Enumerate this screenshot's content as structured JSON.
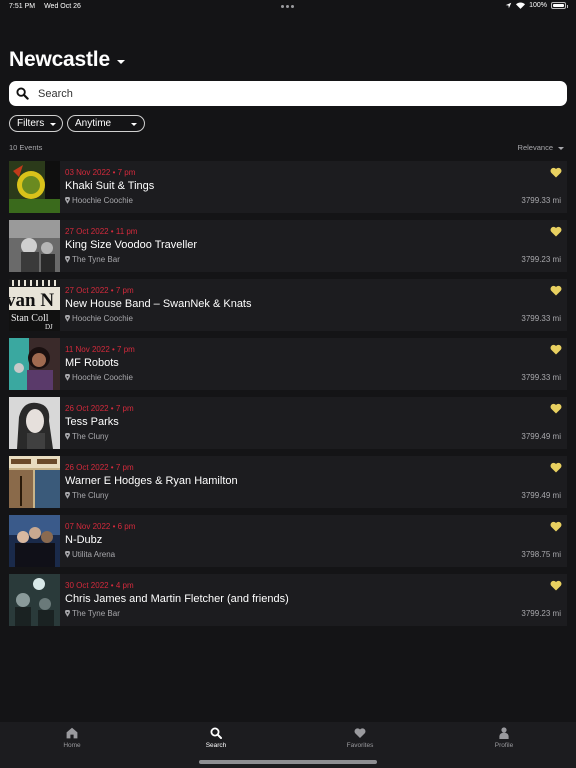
{
  "status_bar": {
    "time": "7:51 PM",
    "date": "Wed Oct 26",
    "battery": "100%"
  },
  "header": {
    "city": "Newcastle"
  },
  "search": {
    "placeholder": "Search"
  },
  "filters": {
    "filters_label": "Filters",
    "time_label": "Anytime"
  },
  "results": {
    "count_label": "10 Events",
    "sort_label": "Relevance"
  },
  "accent_color": "#d42a3c",
  "favorite_color": "#e8d060",
  "events": [
    {
      "date": "03 Nov 2022 • 7 pm",
      "title": "Khaki Suit & Tings",
      "venue": "Hoochie Coochie",
      "distance": "3799.33 mi"
    },
    {
      "date": "27 Oct 2022 • 11 pm",
      "title": "King Size Voodoo Traveller",
      "venue": "The Tyne Bar",
      "distance": "3799.23 mi"
    },
    {
      "date": "27 Oct 2022 • 7 pm",
      "title": "New House Band – SwanNek & Knats",
      "venue": "Hoochie Coochie",
      "distance": "3799.33 mi",
      "thumb_text_1": "van N",
      "thumb_text_2": "Stan Coll",
      "thumb_text_3": "DJ"
    },
    {
      "date": "11 Nov 2022 • 7 pm",
      "title": "MF Robots",
      "venue": "Hoochie Coochie",
      "distance": "3799.33 mi"
    },
    {
      "date": "26 Oct 2022 • 7 pm",
      "title": "Tess Parks",
      "venue": "The Cluny",
      "distance": "3799.49 mi"
    },
    {
      "date": "26 Oct 2022 • 7 pm",
      "title": "Warner E Hodges & Ryan Hamilton",
      "venue": "The Cluny",
      "distance": "3799.49 mi"
    },
    {
      "date": "07 Nov 2022 • 6 pm",
      "title": "N-Dubz",
      "venue": "Utilita Arena",
      "distance": "3798.75 mi"
    },
    {
      "date": "30 Oct 2022 • 4 pm",
      "title": "Chris James and Martin Fletcher (and friends)",
      "venue": "The Tyne Bar",
      "distance": "3799.23 mi"
    }
  ],
  "tabs": [
    {
      "label": "Home",
      "icon": "home-icon"
    },
    {
      "label": "Search",
      "icon": "search-icon"
    },
    {
      "label": "Favorites",
      "icon": "heart-icon"
    },
    {
      "label": "Profile",
      "icon": "person-icon"
    }
  ]
}
